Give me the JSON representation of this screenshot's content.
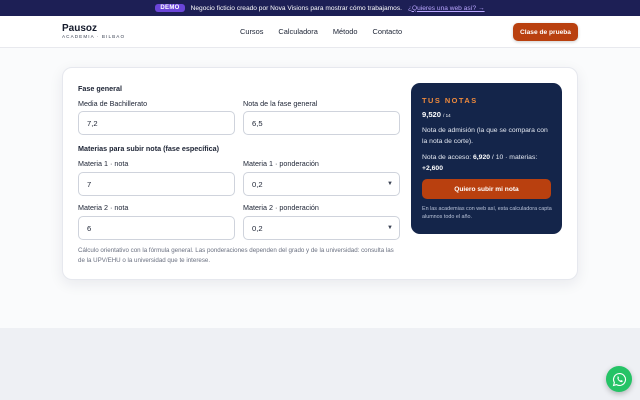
{
  "demo_bar": {
    "badge": "DEMO",
    "text": "Negocio ficticio creado por Nova Visions para mostrar cómo trabajamos.",
    "link": "¿Quieres una web así? →"
  },
  "header": {
    "logo_name": "Pausoz",
    "logo_sub": "ACADEMIA · BILBAO",
    "nav": [
      "Cursos",
      "Calculadora",
      "Método",
      "Contacto"
    ],
    "cta": "Clase de prueba"
  },
  "form": {
    "section_general": "Fase general",
    "bach_label": "Media de Bachillerato",
    "bach_value": "7,2",
    "fase_label": "Nota de la fase general",
    "fase_value": "6,5",
    "section_especifica": "Materias para subir nota (fase específica)",
    "m1_label": "Materia 1 · nota",
    "m1_value": "7",
    "m1p_label": "Materia 1 · ponderación",
    "m1p_value": "0,2",
    "m2_label": "Materia 2 · nota",
    "m2_value": "6",
    "m2p_label": "Materia 2 · ponderación",
    "m2p_value": "0,2",
    "note": "Cálculo orientativo con la fórmula general. Las ponderaciones dependen del grado y de la universidad: consulta las de la UPV/EHU o la universidad que te interese."
  },
  "result": {
    "title": "TUS NOTAS",
    "score": "9,520",
    "score_unit": "/ 14",
    "desc": "Nota de admisión (la que se compara con la nota de corte).",
    "access_prefix": "Nota de acceso:",
    "access_value": "6,920",
    "access_mid": "/ 10 · materias:",
    "access_plus": "+2,600",
    "button": "Quiero subir mi nota",
    "footer": "En las academias con web así, esta calculadora capta alumnos todo el año."
  },
  "colors": {
    "accent": "#b9400f",
    "result_bg": "#14254a",
    "highlight": "#f08a3c",
    "whatsapp": "#25c366",
    "demo_bg": "#1d1f55"
  },
  "icons": {
    "whatsapp": "whatsapp-icon",
    "select_arrow": "chevron-down-icon"
  }
}
